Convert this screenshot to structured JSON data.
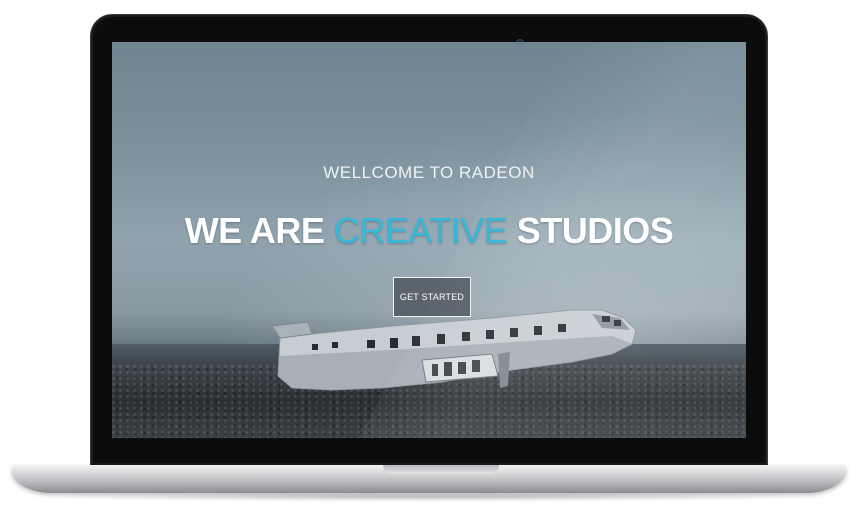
{
  "hero": {
    "welcome_text": "WELLCOME TO RADEON",
    "headline_prefix": "WE ARE",
    "headline_accent": "CREATIVE",
    "headline_suffix": "STUDIOS",
    "cta_label": "GET STARTED"
  },
  "colors": {
    "accent": "#36b8db",
    "headline": "#ffffff",
    "laptop_bezel": "#0c0c0c",
    "laptop_base": "#c8c9cb"
  }
}
